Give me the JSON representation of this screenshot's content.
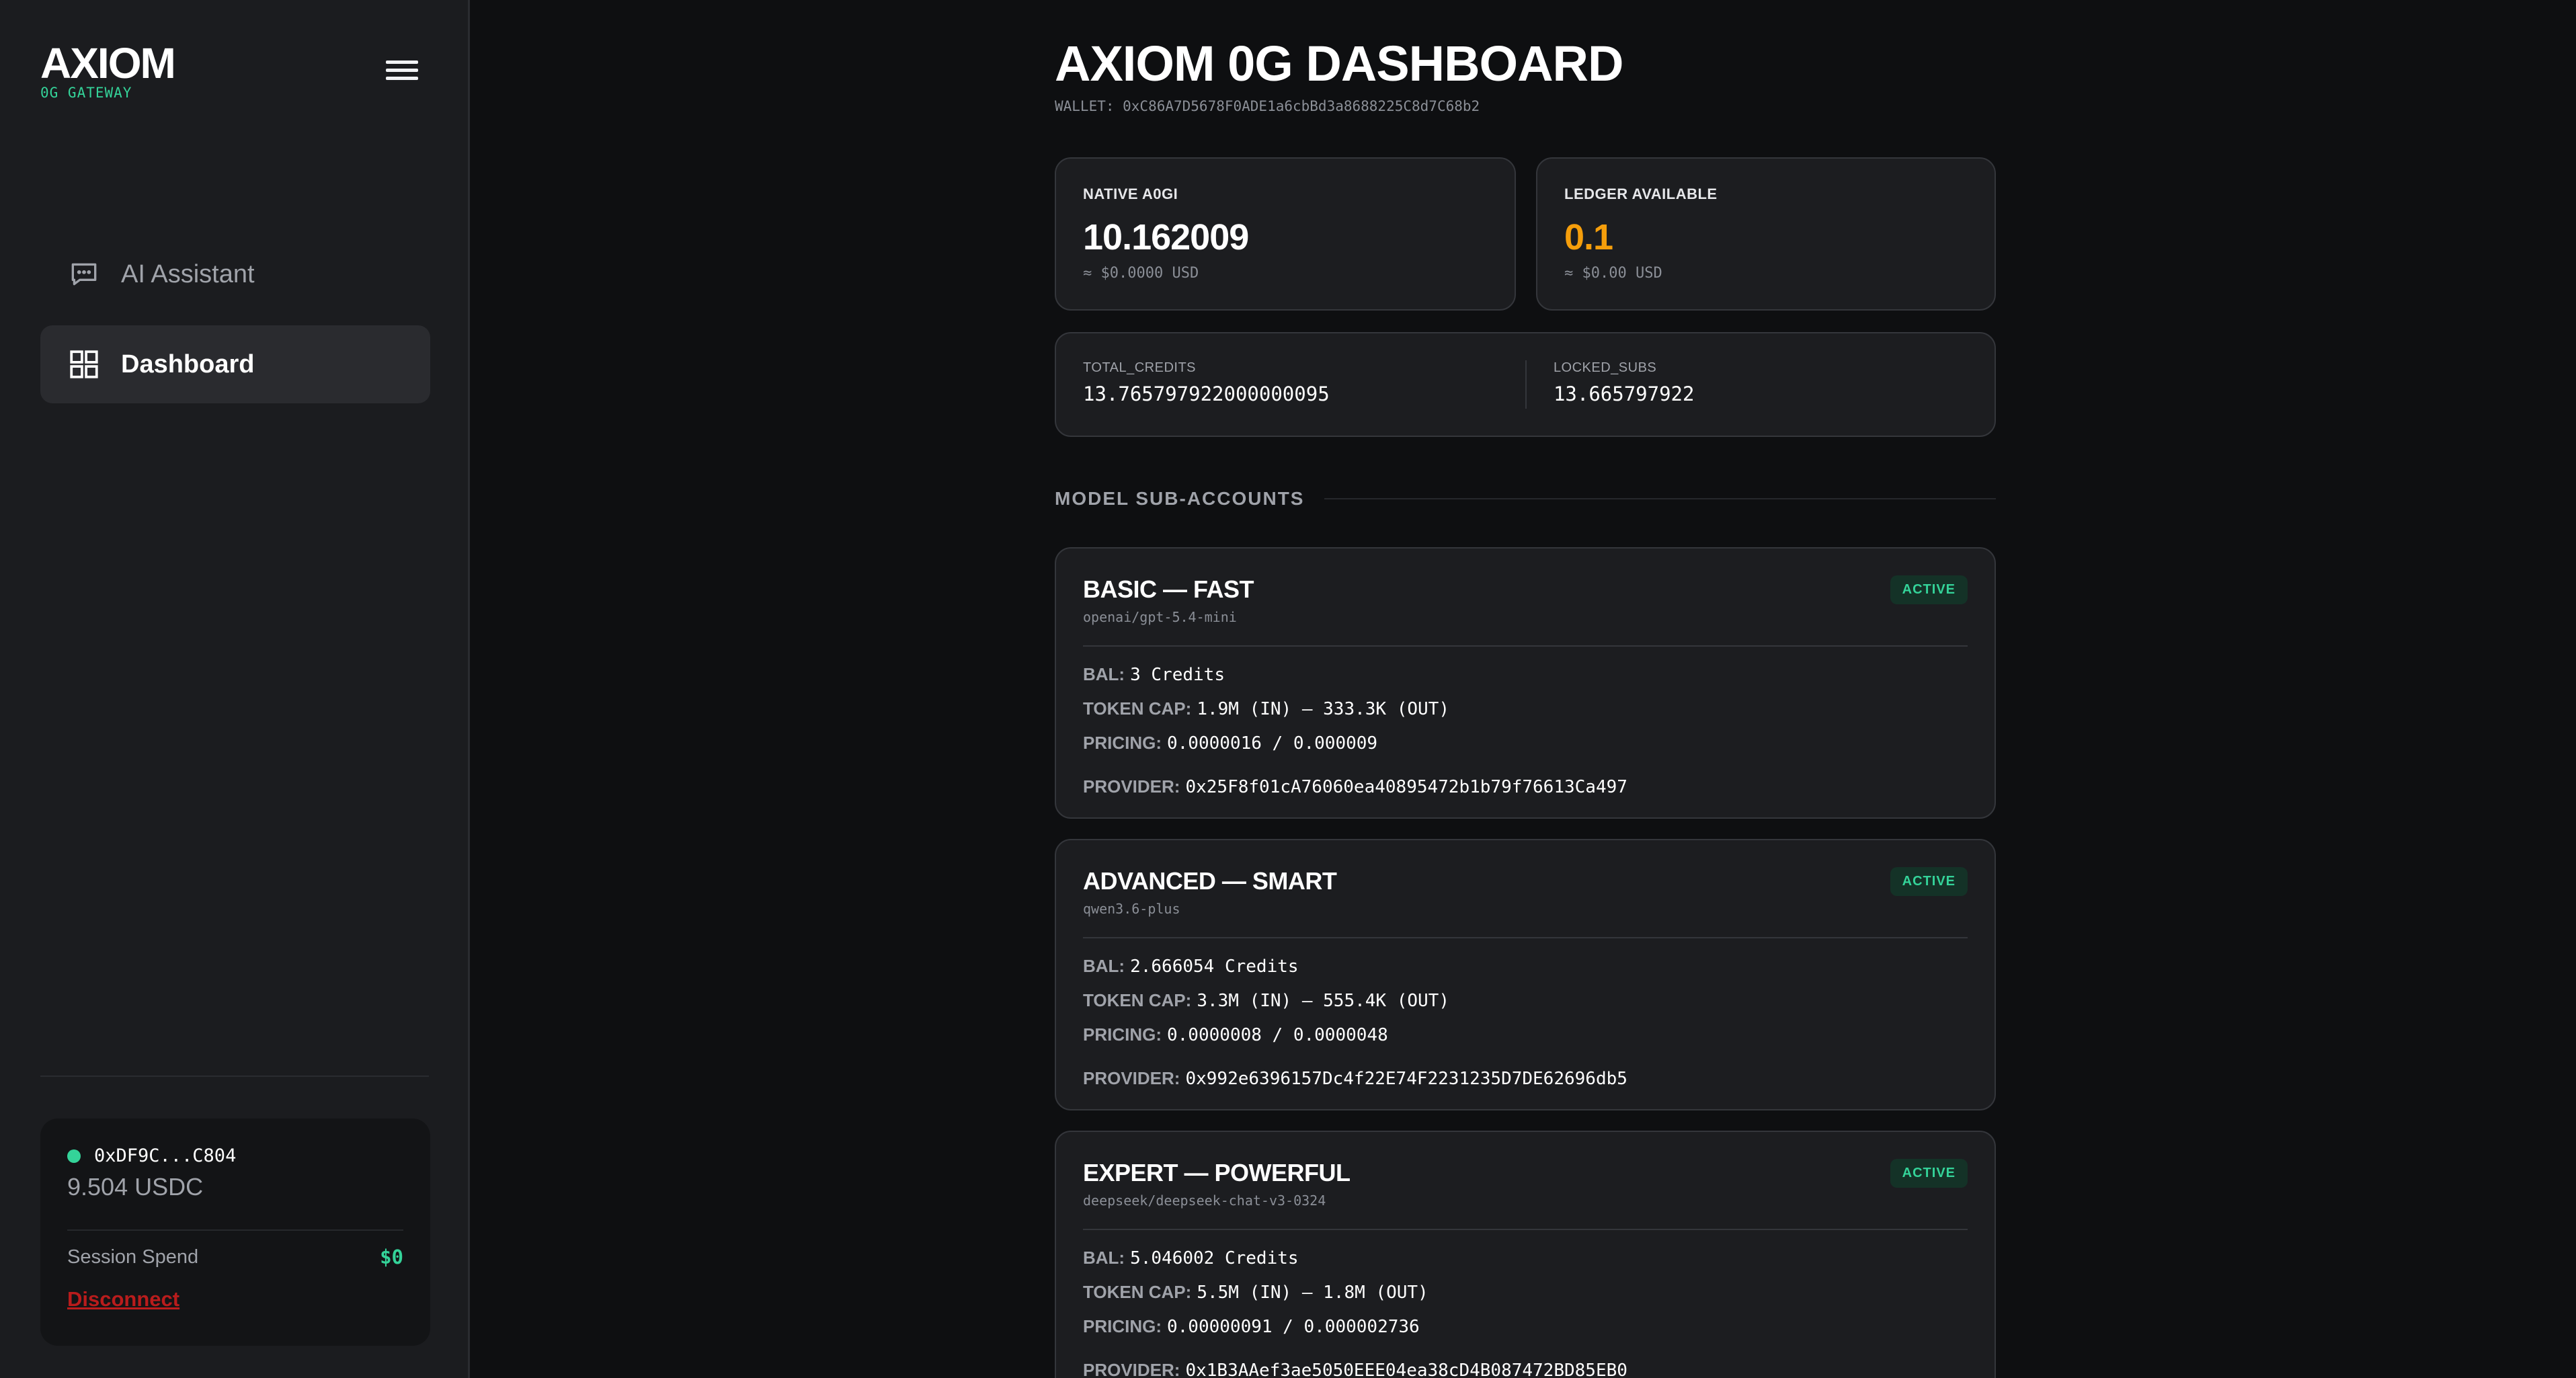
{
  "sidebar": {
    "brand_title": "AXIOM",
    "brand_subtitle": "0G GATEWAY",
    "nav": [
      {
        "label": "AI Assistant",
        "icon": "chat-icon",
        "active": false
      },
      {
        "label": "Dashboard",
        "icon": "grid-icon",
        "active": true
      }
    ],
    "wallet": {
      "address": "0xDF9C...C804",
      "balance": "9.504 USDC",
      "session_spend_label": "Session Spend",
      "session_spend_value": "$0",
      "disconnect_label": "Disconnect"
    }
  },
  "main": {
    "title": "AXIOM 0G DASHBOARD",
    "wallet_line": "WALLET: 0xC86A7D5678F0ADE1a6cbBd3a8688225C8d7C68b2",
    "stats": [
      {
        "label": "NATIVE A0GI",
        "value": "10.162009",
        "usd": "≈ $0.0000 USD"
      },
      {
        "label": "LEDGER AVAILABLE",
        "value": "0.1",
        "usd": "≈ $0.00 USD"
      }
    ],
    "credits": {
      "total_label": "TOTAL_CREDITS",
      "total_value": "13.765797922000000095",
      "locked_label": "LOCKED_SUBS",
      "locked_value": "13.665797922"
    },
    "section_title": "MODEL SUB-ACCOUNTS",
    "labels": {
      "bal": "BAL:",
      "token_cap": "TOKEN CAP:",
      "pricing": "PRICING:",
      "provider": "PROVIDER:"
    },
    "models": [
      {
        "name": "BASIC — FAST",
        "model_id": "openai/gpt-5.4-mini",
        "status": "ACTIVE",
        "bal": "3 Credits",
        "token_cap": "1.9M (IN) — 333.3K (OUT)",
        "pricing": "0.0000016 / 0.000009",
        "provider": "0x25F8f01cA76060ea40895472b1b79f76613Ca497"
      },
      {
        "name": "ADVANCED — SMART",
        "model_id": "qwen3.6-plus",
        "status": "ACTIVE",
        "bal": "2.666054 Credits",
        "token_cap": "3.3M (IN) — 555.4K (OUT)",
        "pricing": "0.0000008 / 0.0000048",
        "provider": "0x992e6396157Dc4f22E74F2231235D7DE62696db5"
      },
      {
        "name": "EXPERT — POWERFUL",
        "model_id": "deepseek/deepseek-chat-v3-0324",
        "status": "ACTIVE",
        "bal": "5.046002 Credits",
        "token_cap": "5.5M (IN) — 1.8M (OUT)",
        "pricing": "0.00000091 / 0.000002736",
        "provider": "0x1B3AAef3ae5050EEE04ea38cD4B087472BD85EB0"
      }
    ]
  },
  "colors": {
    "accent_green": "#34d399",
    "ledger_orange": "#f59e0b",
    "disconnect_red": "#b91c1c"
  }
}
